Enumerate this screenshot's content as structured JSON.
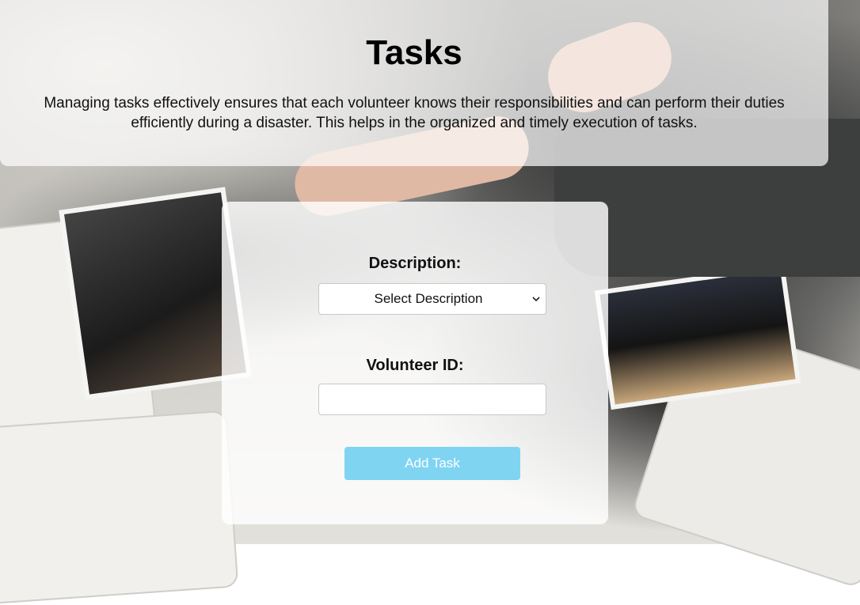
{
  "header": {
    "title": "Tasks",
    "intro": "Managing tasks effectively ensures that each volunteer knows their responsibilities and can perform their duties efficiently during a disaster. This helps in the organized and timely execution of tasks."
  },
  "form": {
    "description_label": "Description:",
    "description_select": {
      "selected": "Select Description"
    },
    "volunteer_label": "Volunteer ID:",
    "volunteer_input": {
      "value": "",
      "placeholder": ""
    },
    "submit_label": "Add Task"
  },
  "colors": {
    "button_bg": "#7fd4f2",
    "button_text": "#ffffff",
    "panel_overlay": "rgba(255,255,255,0.70)"
  },
  "icons": {
    "select_arrow": "chevron-down-icon"
  }
}
